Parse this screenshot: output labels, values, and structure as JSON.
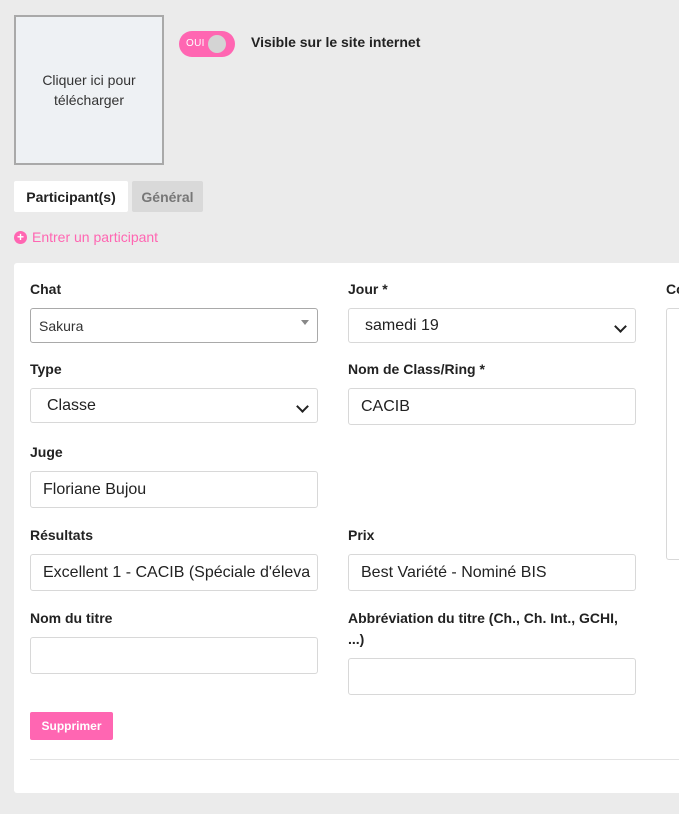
{
  "upload": {
    "label": "Cliquer ici pour télécharger"
  },
  "visibility": {
    "toggle_label": "OUI",
    "label": "Visible sur le site internet"
  },
  "tabs": [
    {
      "label": "Participant(s)",
      "active": true
    },
    {
      "label": "Général",
      "active": false
    }
  ],
  "add_participant": {
    "label": "Entrer un participant"
  },
  "form": {
    "chat": {
      "label": "Chat",
      "value": "Sakura"
    },
    "jour": {
      "label": "Jour *",
      "value": "samedi 19"
    },
    "type": {
      "label": "Type",
      "value": "Classe"
    },
    "ring": {
      "label": "Nom de Class/Ring *",
      "value": "CACIB"
    },
    "juge": {
      "label": "Juge",
      "value": "Floriane Bujou"
    },
    "resultats": {
      "label": "Résultats",
      "value": "Excellent 1 - CACIB (Spéciale d'éleva"
    },
    "prix": {
      "label": "Prix",
      "value": "Best Variété - Nominé BIS"
    },
    "nom_titre": {
      "label": "Nom du titre",
      "value": ""
    },
    "abrev_titre": {
      "label_line1": "Abbréviation du titre (Ch., Ch. Int., GCHI,",
      "label_line2": "...)",
      "value": ""
    },
    "side_label": "Co",
    "delete_label": "Supprimer"
  },
  "colors": {
    "accent": "#ff66b2",
    "background": "#ebebeb"
  }
}
